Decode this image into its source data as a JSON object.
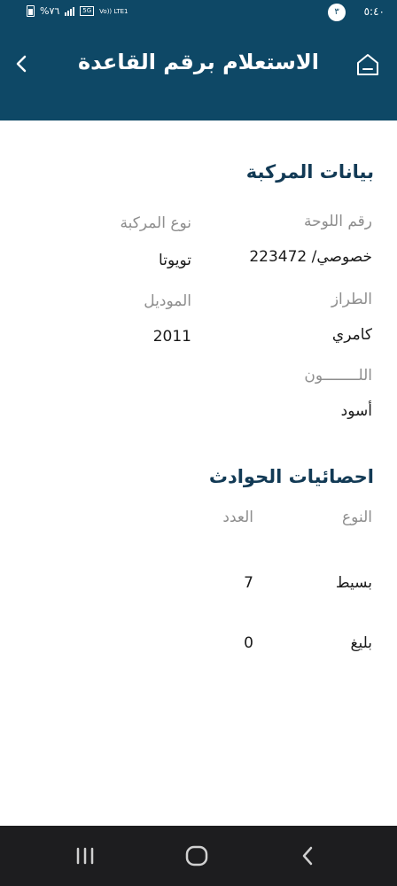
{
  "status_bar": {
    "time": "٥:٤٠",
    "notification_count": "٣",
    "battery": "%٧٦",
    "network": "5G",
    "volte": "Vo)) LTE1"
  },
  "app_bar": {
    "title": "الاستعلام برقم القاعدة",
    "icons": [
      "home-icon",
      "chevron-right-icon"
    ]
  },
  "vehicle": {
    "section_title": "بيانات المركبة",
    "plate_label": "رقم اللوحة",
    "plate_value": "خصوصي/ 223472",
    "type_label": "نوع المركبة",
    "type_value": "تويوتا",
    "model_name_label": "الطراز",
    "model_name_value": "كامري",
    "year_label": "الموديل",
    "year_value": "2011",
    "color_label": "اللــــــــون",
    "color_value": "أسود"
  },
  "accidents": {
    "section_title": "احصائيات الحوادث",
    "headers": {
      "type": "النوع",
      "count": "العدد"
    },
    "rows": [
      {
        "type": "بسيط",
        "count": "7"
      },
      {
        "type": "بليغ",
        "count": "0"
      }
    ]
  },
  "nav_bar": {
    "icons": [
      "recent-apps-icon",
      "home-circle-icon",
      "back-chevron-icon"
    ]
  }
}
